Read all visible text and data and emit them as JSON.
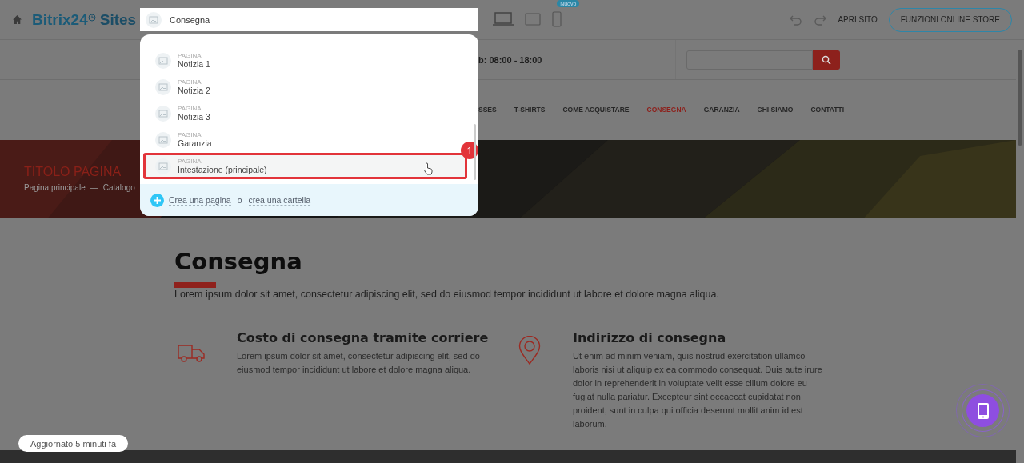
{
  "topbar": {
    "logo_text": "Bitrix24",
    "logo_suffix": "Sites",
    "device_badge": "Nuovo",
    "open_site": "APRI SITO",
    "store_button": "FUNZIONI ONLINE STORE"
  },
  "page_picker": {
    "value": "Consegna",
    "items": [
      {
        "type": "PAGINA",
        "label": "Notizia 1",
        "selected": false
      },
      {
        "type": "PAGINA",
        "label": "Notizia 2",
        "selected": false
      },
      {
        "type": "PAGINA",
        "label": "Notizia 3",
        "selected": false
      },
      {
        "type": "PAGINA",
        "label": "Garanzia",
        "selected": false
      },
      {
        "type": "PAGINA",
        "label": "Intestazione (principale)",
        "selected": true
      }
    ],
    "callout": "1",
    "create_page": "Crea una pagina",
    "separator": "o",
    "create_folder": "crea una cartella"
  },
  "site_header": {
    "hours": "b: 08:00 - 18:00"
  },
  "nav": [
    {
      "label": "SSES",
      "selected": false
    },
    {
      "label": "T-SHIRTS",
      "selected": false
    },
    {
      "label": "COME ACQUISTARE",
      "selected": false
    },
    {
      "label": "CONSEGNA",
      "selected": true
    },
    {
      "label": "GARANZIA",
      "selected": false
    },
    {
      "label": "CHI SIAMO",
      "selected": false
    },
    {
      "label": "CONTATTI",
      "selected": false
    }
  ],
  "hero": {
    "title": "TITOLO PAGINA",
    "breadcrumb": [
      "Pagina principale",
      "Catalogo"
    ],
    "breadcrumb_separator": "—"
  },
  "content": {
    "title": "Consegna",
    "intro": "Lorem ipsum dolor sit amet, consectetur adipiscing elit, sed do eiusmod tempor incididunt ut labore et dolore magna aliqua.",
    "features": [
      {
        "kind": "truck",
        "title": "Costo di consegna tramite corriere",
        "text": "Lorem ipsum dolor sit amet, consectetur adipiscing elit, sed do eiusmod tempor incididunt ut labore et dolore magna aliqua."
      },
      {
        "kind": "pin",
        "title": "Indirizzo di consegna",
        "text": "Ut enim ad minim veniam, quis nostrud exercitation ullamco laboris nisi ut aliquip ex ea commodo consequat. Duis aute irure dolor in reprehenderit in voluptate velit esse cillum dolore eu fugiat nulla pariatur. Excepteur sint occaecat cupidatat non proident, sunt in culpa qui officia deserunt mollit anim id est laborum."
      }
    ]
  },
  "status": "Aggiornato 5 minuti fa"
}
